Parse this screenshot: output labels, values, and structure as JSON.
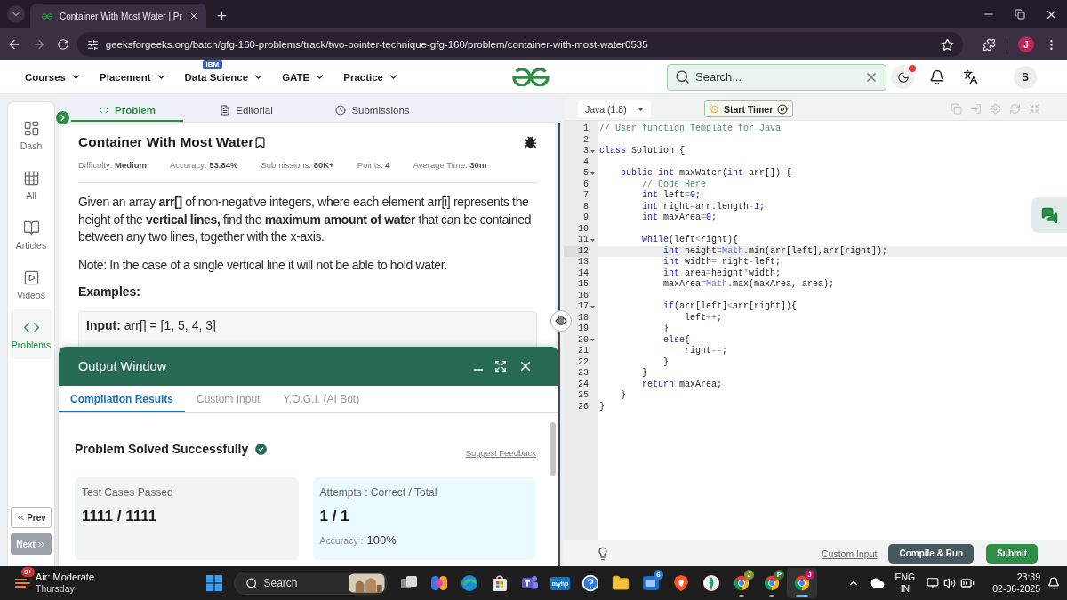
{
  "browser": {
    "tabs": [
      {
        "title": "Container With Most Water | Pr",
        "selected": true
      }
    ],
    "address": "geeksforgeeks.org/batch/gfg-160-problems/track/two-pointer-technique-gfg-160/problem/container-with-most-water0535",
    "profile_initial": "J"
  },
  "site_header": {
    "nav": [
      {
        "label": "Courses"
      },
      {
        "label": "Placement"
      },
      {
        "label": "Data Science",
        "badge": "IBM"
      },
      {
        "label": "GATE"
      },
      {
        "label": "Practice"
      }
    ],
    "search": {
      "placeholder": "Search..."
    },
    "notification_dot": true,
    "avatar_initial": "S"
  },
  "sidebar": {
    "items": [
      {
        "kind": "dash",
        "label": "Dash",
        "selected": false
      },
      {
        "kind": "all",
        "label": "All",
        "selected": false
      },
      {
        "kind": "articles",
        "label": "Articles",
        "selected": false
      },
      {
        "kind": "videos",
        "label": "Videos",
        "selected": false
      },
      {
        "kind": "problems",
        "label": "Problems",
        "selected": true
      }
    ],
    "prev": {
      "label": "Prev",
      "disabled": false
    },
    "next": {
      "label": "Next",
      "disabled": true
    }
  },
  "problem_tabs": [
    {
      "kind": "problem",
      "label": "Problem",
      "selected": true
    },
    {
      "kind": "editorial",
      "label": "Editorial",
      "selected": false
    },
    {
      "kind": "submissions",
      "label": "Submissions",
      "selected": false
    }
  ],
  "problem": {
    "title": "Container With Most Water",
    "meta": [
      {
        "label": "Difficulty:",
        "value": "Medium"
      },
      {
        "label": "Accuracy:",
        "value": "53.84%"
      },
      {
        "label": "Submissions:",
        "value": "80K+"
      },
      {
        "label": "Points:",
        "value": "4"
      },
      {
        "label": "Average Time:",
        "value": "30m"
      }
    ],
    "description": "Given an array **arr[]** of non-negative integers, where each element arr[i] represents the height of the **vertical lines,** find the **maximum amount of water** that can be contained between any two lines, together with the x-axis.",
    "note": "Note: In the case of a single vertical line it will not be able to hold water.",
    "examples_heading": "Examples:",
    "examples": [
      {
        "input": "**Input:** arr[] = [1, 5, 4, 3]"
      }
    ]
  },
  "output_window": {
    "title": "Output Window",
    "tabs": [
      {
        "label": "Compilation Results",
        "selected": true
      },
      {
        "label": "Custom Input",
        "selected": false
      },
      {
        "label": "Y.O.G.I. (AI Bot)",
        "selected": false
      }
    ],
    "status": "Problem Solved Successfully",
    "feedback_link": "Suggest Feedback",
    "cards": [
      {
        "kind": "tests",
        "label": "Test Cases Passed",
        "value": "1111 / 1111"
      },
      {
        "kind": "attempts",
        "label": "Attempts : Correct / Total",
        "value": "1 / 1",
        "accuracy_label": "Accuracy :",
        "accuracy_value": "100%"
      }
    ]
  },
  "editor": {
    "language": "Java (1.8)",
    "timer_button": "Start Timer",
    "lines": [
      {
        "number": "1",
        "foldable": false,
        "current": false,
        "tokens": [
          {
            "kind": "comment",
            "text": "// User function Template for Java"
          }
        ]
      },
      {
        "number": "2",
        "foldable": false,
        "current": false
      },
      {
        "number": "3",
        "foldable": true,
        "current": false,
        "tokens": [
          {
            "kind": "keyword",
            "text": "class"
          },
          {
            "kind": "plain",
            "text": " Solution {"
          }
        ]
      },
      {
        "number": "4",
        "foldable": false,
        "current": false
      },
      {
        "number": "5",
        "foldable": true,
        "current": false,
        "tokens": [
          {
            "kind": "keyword",
            "text": "    public"
          },
          {
            "kind": "keyword",
            "text": " int"
          },
          {
            "kind": "plain",
            "text": " maxWater("
          },
          {
            "kind": "keyword",
            "text": "int"
          },
          {
            "kind": "plain",
            "text": " arr[]) {"
          }
        ]
      },
      {
        "number": "6",
        "foldable": false,
        "current": false,
        "tokens": [
          {
            "kind": "comment",
            "text": "        // Code Here"
          }
        ]
      },
      {
        "number": "7",
        "foldable": false,
        "current": false,
        "tokens": [
          {
            "kind": "keyword",
            "text": "        int"
          },
          {
            "kind": "plain",
            "text": " left"
          },
          {
            "kind": "operator",
            "text": "="
          },
          {
            "kind": "number",
            "text": "0"
          },
          {
            "kind": "plain",
            "text": ";"
          }
        ]
      },
      {
        "number": "8",
        "foldable": false,
        "current": false,
        "tokens": [
          {
            "kind": "keyword",
            "text": "        int"
          },
          {
            "kind": "plain",
            "text": " right"
          },
          {
            "kind": "operator",
            "text": "="
          },
          {
            "kind": "plain",
            "text": "arr.length"
          },
          {
            "kind": "operator",
            "text": "-"
          },
          {
            "kind": "number",
            "text": "1"
          },
          {
            "kind": "plain",
            "text": ";"
          }
        ]
      },
      {
        "number": "9",
        "foldable": false,
        "current": false,
        "tokens": [
          {
            "kind": "keyword",
            "text": "        int"
          },
          {
            "kind": "plain",
            "text": " maxArea"
          },
          {
            "kind": "operator",
            "text": "="
          },
          {
            "kind": "number",
            "text": "0"
          },
          {
            "kind": "plain",
            "text": ";"
          }
        ]
      },
      {
        "number": "10",
        "foldable": false,
        "current": false
      },
      {
        "number": "11",
        "foldable": true,
        "current": false,
        "tokens": [
          {
            "kind": "keyword",
            "text": "        while"
          },
          {
            "kind": "plain",
            "text": "(left"
          },
          {
            "kind": "operator",
            "text": "<"
          },
          {
            "kind": "plain",
            "text": "right){"
          }
        ]
      },
      {
        "number": "12",
        "foldable": false,
        "current": true,
        "tokens": [
          {
            "kind": "keyword",
            "text": "            int"
          },
          {
            "kind": "plain",
            "text": " height"
          },
          {
            "kind": "operator",
            "text": "="
          },
          {
            "kind": "function",
            "text": "Math"
          },
          {
            "kind": "plain",
            "text": ".min(arr[left],arr[right]);"
          }
        ]
      },
      {
        "number": "13",
        "foldable": false,
        "current": false,
        "tokens": [
          {
            "kind": "keyword",
            "text": "            int"
          },
          {
            "kind": "plain",
            "text": " width"
          },
          {
            "kind": "operator",
            "text": "="
          },
          {
            "kind": "plain",
            "text": " right"
          },
          {
            "kind": "operator",
            "text": "-"
          },
          {
            "kind": "plain",
            "text": "left;"
          }
        ]
      },
      {
        "number": "14",
        "foldable": false,
        "current": false,
        "tokens": [
          {
            "kind": "keyword",
            "text": "            int"
          },
          {
            "kind": "plain",
            "text": " area"
          },
          {
            "kind": "operator",
            "text": "="
          },
          {
            "kind": "plain",
            "text": "height"
          },
          {
            "kind": "operator",
            "text": "*"
          },
          {
            "kind": "plain",
            "text": "width;"
          }
        ]
      },
      {
        "number": "15",
        "foldable": false,
        "current": false,
        "tokens": [
          {
            "kind": "plain",
            "text": "            maxArea"
          },
          {
            "kind": "operator",
            "text": "="
          },
          {
            "kind": "function",
            "text": "Math"
          },
          {
            "kind": "plain",
            "text": ".max(maxArea, area);"
          }
        ]
      },
      {
        "number": "16",
        "foldable": false,
        "current": false
      },
      {
        "number": "17",
        "foldable": true,
        "current": false,
        "tokens": [
          {
            "kind": "keyword",
            "text": "            if"
          },
          {
            "kind": "plain",
            "text": "(arr[left]"
          },
          {
            "kind": "operator",
            "text": "<"
          },
          {
            "kind": "plain",
            "text": "arr[right]){"
          }
        ]
      },
      {
        "number": "18",
        "foldable": false,
        "current": false,
        "tokens": [
          {
            "kind": "plain",
            "text": "                left"
          },
          {
            "kind": "operator",
            "text": "++"
          },
          {
            "kind": "plain",
            "text": ";"
          }
        ]
      },
      {
        "number": "19",
        "foldable": false,
        "current": false,
        "tokens": [
          {
            "kind": "plain",
            "text": "            }"
          }
        ]
      },
      {
        "number": "20",
        "foldable": true,
        "current": false,
        "tokens": [
          {
            "kind": "keyword",
            "text": "            else"
          },
          {
            "kind": "plain",
            "text": "{"
          }
        ]
      },
      {
        "number": "21",
        "foldable": false,
        "current": false,
        "tokens": [
          {
            "kind": "plain",
            "text": "                right"
          },
          {
            "kind": "operator",
            "text": "--"
          },
          {
            "kind": "plain",
            "text": ";"
          }
        ]
      },
      {
        "number": "22",
        "foldable": false,
        "current": false,
        "tokens": [
          {
            "kind": "plain",
            "text": "            }"
          }
        ]
      },
      {
        "number": "23",
        "foldable": false,
        "current": false,
        "tokens": [
          {
            "kind": "plain",
            "text": "        }"
          }
        ]
      },
      {
        "number": "24",
        "foldable": false,
        "current": false,
        "tokens": [
          {
            "kind": "keyword",
            "text": "        return"
          },
          {
            "kind": "plain",
            "text": " maxArea;"
          }
        ]
      },
      {
        "number": "25",
        "foldable": false,
        "current": false,
        "tokens": [
          {
            "kind": "plain",
            "text": "    }"
          }
        ]
      },
      {
        "number": "26",
        "foldable": false,
        "current": false,
        "tokens": [
          {
            "kind": "plain",
            "text": "}"
          }
        ]
      }
    ],
    "custom_input_link": "Custom Input",
    "compile_button": "Compile & Run",
    "submit_button": "Submit"
  },
  "taskbar": {
    "weather": {
      "badge": "9+",
      "title": "Air: Moderate",
      "subtitle": "Thursday"
    },
    "search": {
      "placeholder": "Search"
    },
    "apps": [
      {
        "kind": "taskview",
        "open": false,
        "selected": false
      },
      {
        "kind": "copilot",
        "open": false,
        "selected": false
      },
      {
        "kind": "edge",
        "open": false,
        "selected": false
      },
      {
        "kind": "store",
        "open": false,
        "selected": false
      },
      {
        "kind": "teams",
        "open": false,
        "selected": false
      },
      {
        "kind": "myhp",
        "label": "myhp",
        "open": false,
        "selected": false
      },
      {
        "kind": "help",
        "open": false,
        "selected": false
      },
      {
        "kind": "folder",
        "open": false,
        "selected": false
      },
      {
        "kind": "tile",
        "badge": "6",
        "open": false,
        "selected": false
      },
      {
        "kind": "lion",
        "open": false,
        "selected": false
      },
      {
        "kind": "leaf",
        "open": false,
        "selected": false
      },
      {
        "kind": "chrome",
        "badge": "J",
        "color": "#7a9a2e",
        "open": true,
        "selected": false
      },
      {
        "kind": "chrome",
        "badge": "P",
        "color": "#2e7d32",
        "open": true,
        "selected": false
      },
      {
        "kind": "chrome",
        "badge": "J",
        "color": "#c2185b",
        "open": true,
        "selected": true
      }
    ],
    "tray": {
      "language": "ENG",
      "region": "IN",
      "time": "23:39",
      "date": "02-06-2025"
    }
  }
}
